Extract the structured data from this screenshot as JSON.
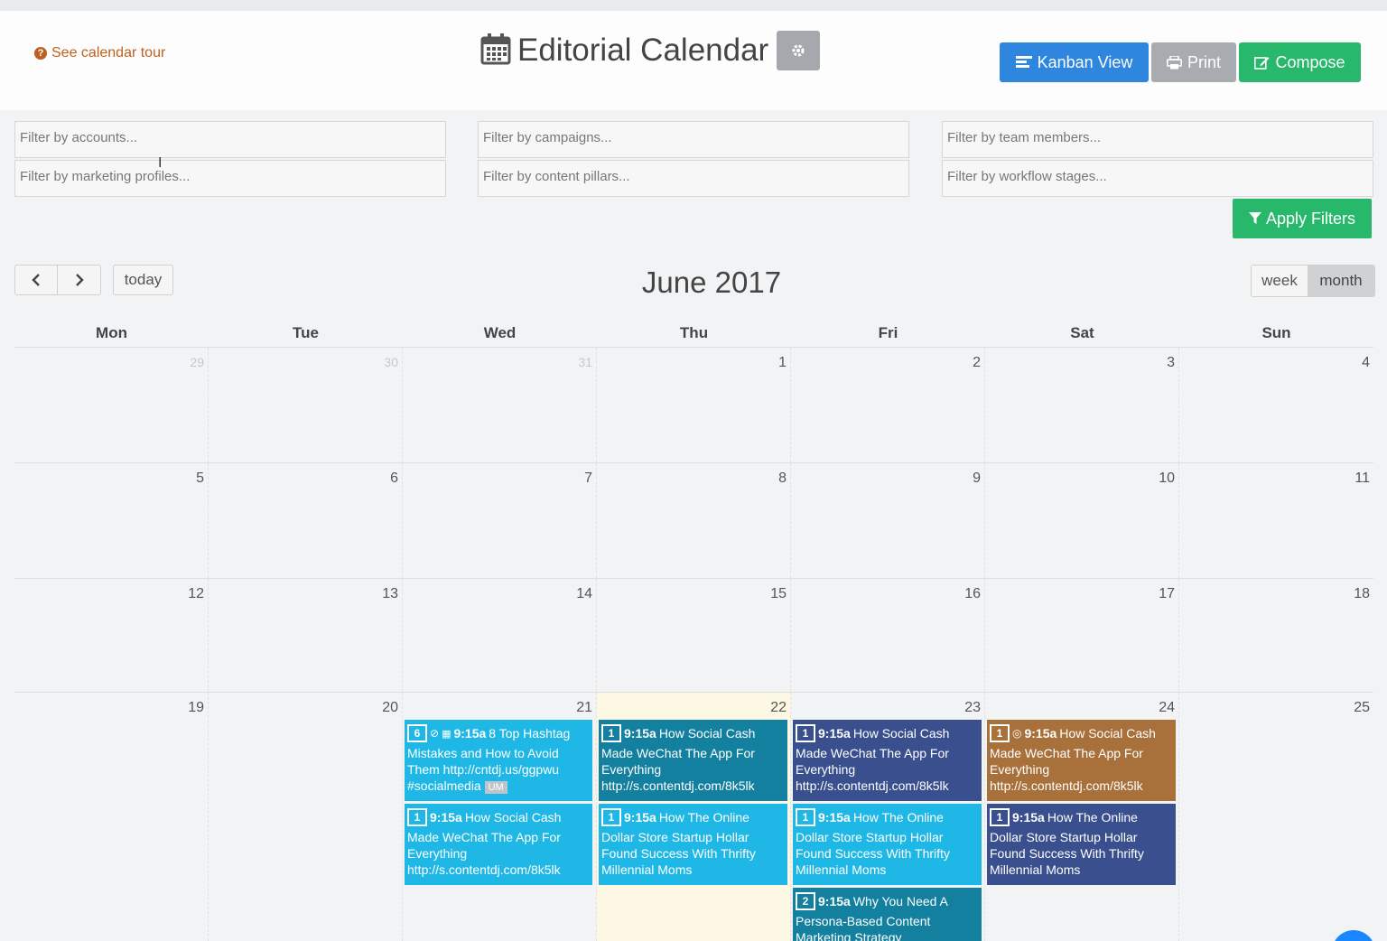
{
  "header": {
    "tour_label": "See calendar tour",
    "title": "Editorial Calendar",
    "buttons": {
      "kanban": "Kanban View",
      "print": "Print",
      "compose": "Compose"
    }
  },
  "filters": {
    "accounts": "Filter by accounts...",
    "marketing_profiles": "Filter by marketing profiles...",
    "campaigns": "Filter by campaigns...",
    "content_pillars": "Filter by content pillars...",
    "team_members": "Filter by team members...",
    "workflow_stages": "Filter by workflow stages...",
    "apply_label": "Apply Filters"
  },
  "toolbar": {
    "today": "today",
    "month_title": "June 2017",
    "week": "week",
    "month": "month"
  },
  "calendar": {
    "days_of_week": [
      "Mon",
      "Tue",
      "Wed",
      "Thu",
      "Fri",
      "Sat",
      "Sun"
    ],
    "weeks": [
      [
        "29",
        "30",
        "31",
        "1",
        "2",
        "3",
        "4"
      ],
      [
        "5",
        "6",
        "7",
        "8",
        "9",
        "10",
        "11"
      ],
      [
        "12",
        "13",
        "14",
        "15",
        "16",
        "17",
        "18"
      ],
      [
        "19",
        "20",
        "21",
        "22",
        "23",
        "24",
        "25"
      ]
    ]
  },
  "events": {
    "wed_1": {
      "count": "6",
      "time": "9:15a",
      "title": "8 Top Hashtag",
      "body": "Mistakes and How to Avoid Them http://cntdj.us/ggpwu #socialmedia",
      "badge": "UM"
    },
    "wed_2": {
      "count": "1",
      "time": "9:15a",
      "title": "How Social Cash",
      "body": "Made WeChat The App For Everything http://s.contentdj.com/8k5lk"
    },
    "thu_1": {
      "count": "1",
      "time": "9:15a",
      "title": "How Social Cash",
      "body": "Made WeChat The App For Everything http://s.contentdj.com/8k5lk"
    },
    "thu_2": {
      "count": "1",
      "time": "9:15a",
      "title": "How The Online",
      "body": "Dollar Store Startup Hollar Found Success With Thrifty Millennial Moms"
    },
    "fri_1": {
      "count": "1",
      "time": "9:15a",
      "title": "How Social Cash",
      "body": "Made WeChat The App For Everything http://s.contentdj.com/8k5lk"
    },
    "fri_2": {
      "count": "1",
      "time": "9:15a",
      "title": "How The Online",
      "body": "Dollar Store Startup Hollar Found Success With Thrifty Millennial Moms"
    },
    "fri_3": {
      "count": "2",
      "time": "9:15a",
      "title": "Why You Need A",
      "body": "Persona-Based Content Marketing Strategy"
    },
    "sat_1": {
      "count": "1",
      "time": "9:15a",
      "title": "How Social Cash",
      "body": "Made WeChat The App For Everything http://s.contentdj.com/8k5lk"
    },
    "sat_2": {
      "count": "1",
      "time": "9:15a",
      "title": "How The Online",
      "body": "Dollar Store Startup Hollar Found Success With Thrifty Millennial Moms"
    }
  },
  "colors": {
    "cyan": "#1fb8e6",
    "teal": "#13809f",
    "navy": "#3a4f8e",
    "brown": "#a8703a",
    "green": "#27b86b",
    "blue": "#2e86de"
  }
}
